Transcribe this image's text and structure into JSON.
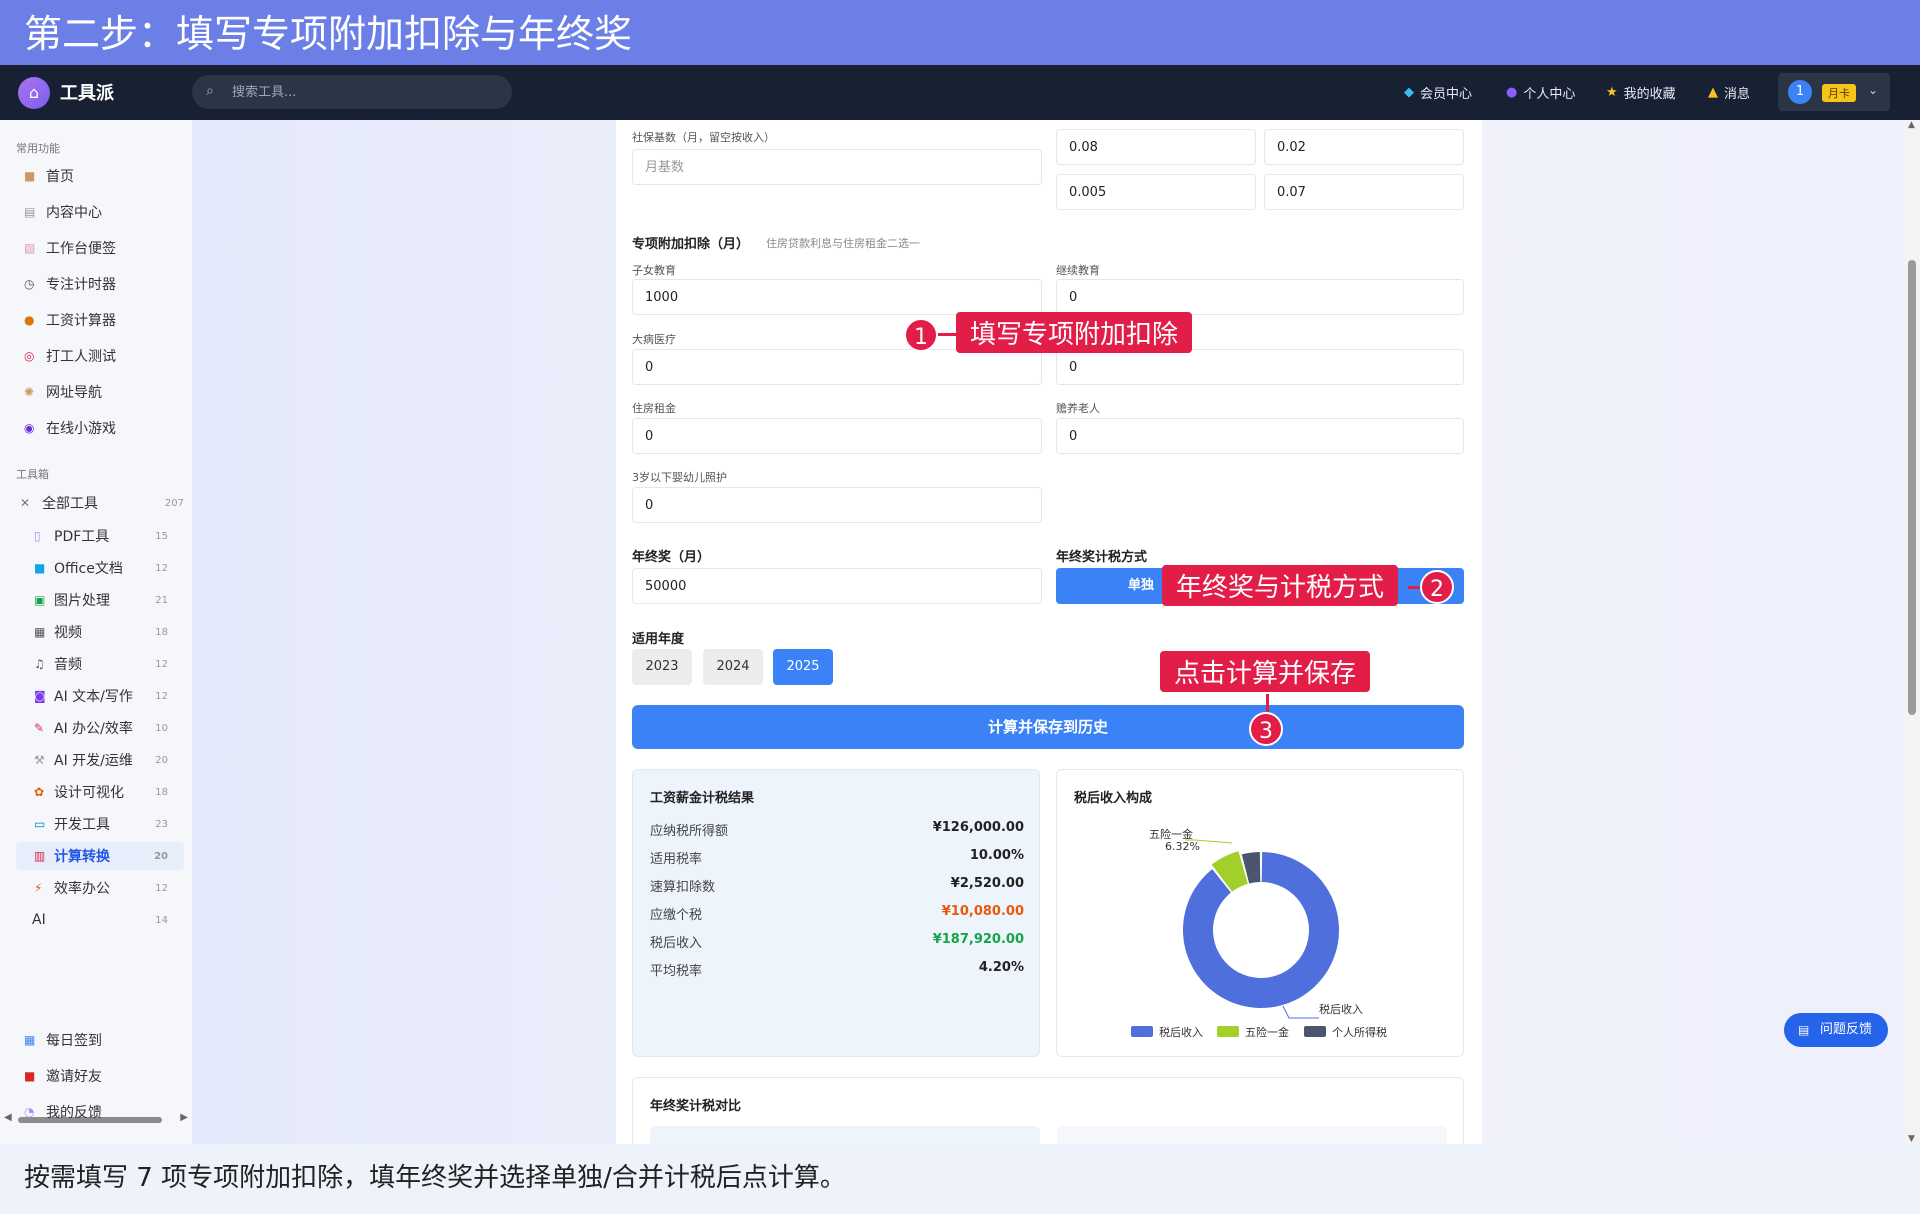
{
  "banner": {
    "title": "第二步：填写专项附加扣除与年终奖"
  },
  "navbar": {
    "logo_text": "工具派",
    "search_placeholder": "搜索工具...",
    "items": [
      {
        "label": "会员中心",
        "icon": "gem-icon"
      },
      {
        "label": "个人中心",
        "icon": "person-icon"
      },
      {
        "label": "我的收藏",
        "icon": "star-icon"
      },
      {
        "label": "消息",
        "icon": "bell-icon"
      }
    ],
    "user": {
      "avatar": "1",
      "badge": "月卡"
    }
  },
  "sidebar": {
    "common_title": "常用功能",
    "common": [
      {
        "label": "首页"
      },
      {
        "label": "内容中心"
      },
      {
        "label": "工作台便签"
      },
      {
        "label": "专注计时器"
      },
      {
        "label": "工资计算器"
      },
      {
        "label": "打工人测试"
      },
      {
        "label": "网址导航"
      },
      {
        "label": "在线小游戏"
      }
    ],
    "toolbox_title": "工具箱",
    "all_tools": {
      "label": "全部工具",
      "count": "207"
    },
    "categories": [
      {
        "label": "PDF工具",
        "count": "15"
      },
      {
        "label": "Office文档",
        "count": "12"
      },
      {
        "label": "图片处理",
        "count": "21"
      },
      {
        "label": "视频",
        "count": "18"
      },
      {
        "label": "音频",
        "count": "12"
      },
      {
        "label": "AI 文本/写作",
        "count": "12"
      },
      {
        "label": "AI 办公/效率",
        "count": "10"
      },
      {
        "label": "AI 开发/运维",
        "count": "20"
      },
      {
        "label": "设计可视化",
        "count": "18"
      },
      {
        "label": "开发工具",
        "count": "23"
      },
      {
        "label": "计算转换",
        "count": "20"
      },
      {
        "label": "效率办公",
        "count": "12"
      },
      {
        "label": "AI",
        "count": "14"
      }
    ],
    "bottom": [
      {
        "label": "每日签到"
      },
      {
        "label": "邀请好友"
      },
      {
        "label": "我的反馈"
      }
    ]
  },
  "form": {
    "social_base_label": "社保基数（月，留空按收入）",
    "social_base_placeholder": "月基数",
    "rates": [
      "0.08",
      "0.02",
      "0.005",
      "0.07"
    ],
    "deduction_title": "专项附加扣除（月）",
    "deduction_hint": "住房贷款利息与住房租金二选一",
    "deductions": {
      "child_edu": {
        "label": "子女教育",
        "value": "1000"
      },
      "continue_edu": {
        "label": "继续教育",
        "value": "0"
      },
      "medical": {
        "label": "大病医疗",
        "value": "0"
      },
      "loan": {
        "value": "0"
      },
      "rent": {
        "label": "住房租金",
        "value": "0"
      },
      "elder": {
        "label": "赡养老人",
        "value": "0"
      },
      "infant": {
        "label": "3岁以下婴幼儿照护",
        "value": "0"
      }
    },
    "bonus_label": "年终奖（月）",
    "bonus_value": "50000",
    "bonus_mode_label": "年终奖计税方式",
    "bonus_mode_value": "单独",
    "year_label": "适用年度",
    "years": [
      "2023",
      "2024",
      "2025"
    ],
    "calc_button": "计算并保存到历史"
  },
  "result": {
    "title": "工资薪金计税结果",
    "rows": [
      {
        "label": "应纳税所得额",
        "value": "¥126,000.00",
        "color": "#222222"
      },
      {
        "label": "适用税率",
        "value": "10.00%",
        "color": "#222222"
      },
      {
        "label": "速算扣除数",
        "value": "¥2,520.00",
        "color": "#222222"
      },
      {
        "label": "应缴个税",
        "value": "¥10,080.00",
        "color": "#ea580c"
      },
      {
        "label": "税后收入",
        "value": "¥187,920.00",
        "color": "#16a34a"
      },
      {
        "label": "平均税率",
        "value": "4.20%",
        "color": "#222222"
      }
    ]
  },
  "chart_data": {
    "type": "pie",
    "title": "税后收入构成",
    "labels": [
      "税后收入",
      "五险一金",
      "个人所得税"
    ],
    "values": [
      89.48,
      6.32,
      4.2
    ],
    "colors": [
      "#4e6fdc",
      "#a3cf2a",
      "#4a5570"
    ],
    "legend": [
      "税后收入",
      "五险一金",
      "个人所得税"
    ],
    "legend_position": "bottom",
    "callouts": [
      {
        "name": "五险一金",
        "pct": "6.32%"
      },
      {
        "name": "税后收入",
        "pct": ""
      }
    ]
  },
  "comparison": {
    "title": "年终奖计税对比"
  },
  "feedback_button": "问题反馈",
  "annotations": [
    {
      "num": "1",
      "text": "填写专项附加扣除"
    },
    {
      "num": "2",
      "text": "年终奖与计税方式"
    },
    {
      "num": "3",
      "text": "点击计算并保存"
    }
  ],
  "caption": "按需填写 7 项专项附加扣除，填年终奖并选择单独/合并计税后点计算。"
}
